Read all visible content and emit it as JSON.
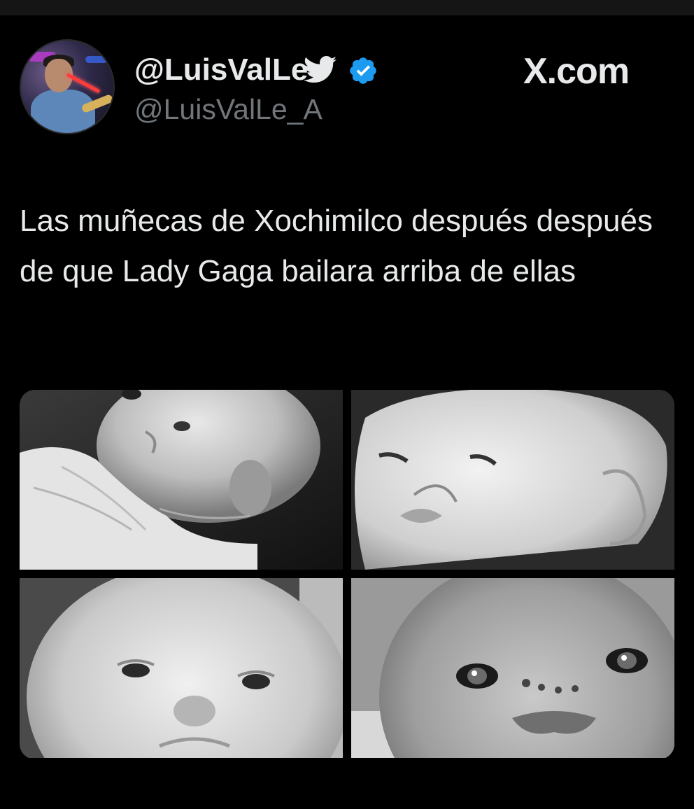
{
  "tweet": {
    "display_name": "@LuisValLe",
    "handle": "@LuisValLe_A",
    "brand": "X.com",
    "text": "Las muñecas de Xochimilco después después de que Lady Gaga bailara arriba de ellas",
    "verified_color": "#1d9bf0",
    "icons": {
      "bird": "twitter-bird-icon",
      "verified": "verified-badge-icon"
    },
    "media": [
      {
        "id": "photo-1",
        "description_tag": "doll-photo"
      },
      {
        "id": "photo-2",
        "description_tag": "doll-photo"
      },
      {
        "id": "photo-3",
        "description_tag": "doll-photo"
      },
      {
        "id": "photo-4",
        "description_tag": "doll-photo"
      }
    ]
  },
  "colors": {
    "background": "#000000",
    "text_primary": "#e7e9ea",
    "text_secondary": "#71767b"
  }
}
